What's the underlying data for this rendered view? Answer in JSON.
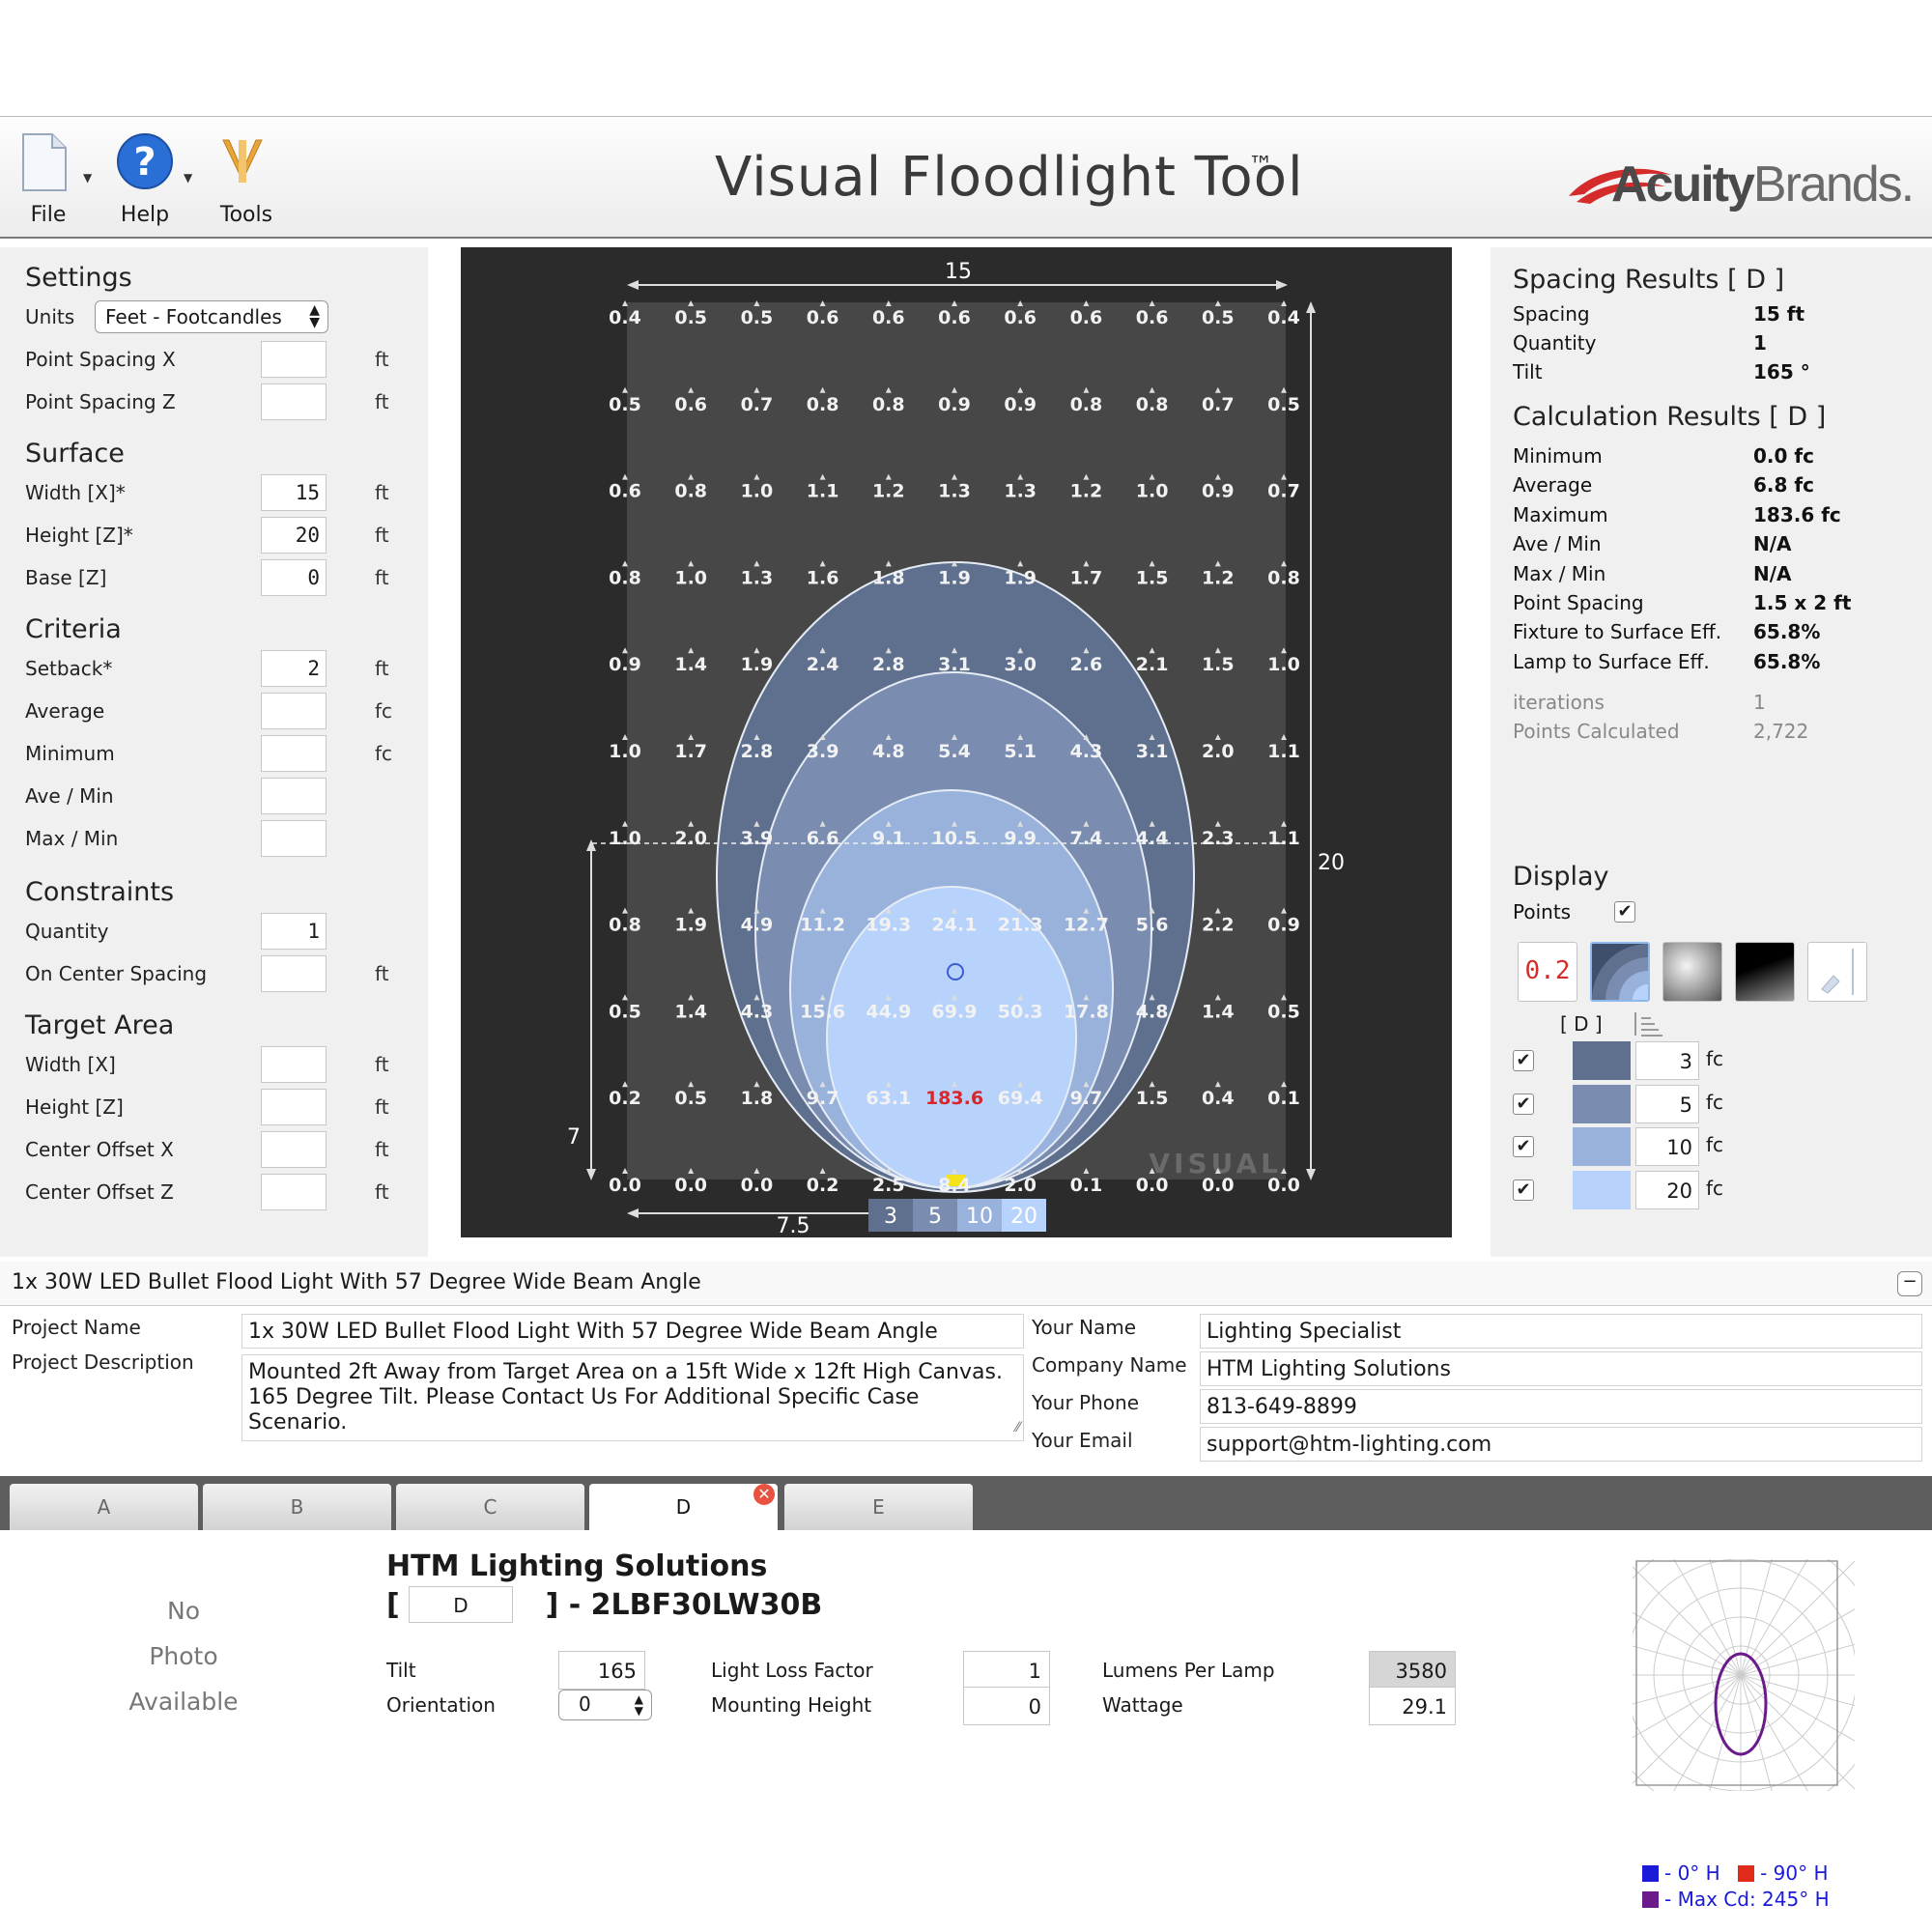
{
  "toolbar": {
    "file_label": "File",
    "help_label": "Help",
    "tools_label": "Tools"
  },
  "header": {
    "title": "Visual Floodlight Tool",
    "trademark": "™",
    "brand_bold": "Acuity",
    "brand_light": "Brands."
  },
  "settings": {
    "title": "Settings",
    "units_label": "Units",
    "units_value": "Feet - Footcandles",
    "point_spacing_x_label": "Point Spacing X",
    "point_spacing_x_value": "",
    "point_spacing_z_label": "Point Spacing Z",
    "point_spacing_z_value": "",
    "unit_ft": "ft",
    "unit_fc": "fc"
  },
  "surface": {
    "title": "Surface",
    "width_label": "Width  [X]*",
    "width_value": "15",
    "height_label": "Height [Z]*",
    "height_value": "20",
    "base_label": "Base   [Z]",
    "base_value": "0"
  },
  "criteria": {
    "title": "Criteria",
    "setback_label": "Setback*",
    "setback_value": "2",
    "average_label": "Average",
    "average_value": "",
    "minimum_label": "Minimum",
    "minimum_value": "",
    "ave_min_label": "Ave  /  Min",
    "ave_min_value": "",
    "max_min_label": "Max  /  Min",
    "max_min_value": ""
  },
  "constraints": {
    "title": "Constraints",
    "quantity_label": "Quantity",
    "quantity_value": "1",
    "ocs_label": "On Center Spacing",
    "ocs_value": ""
  },
  "target_area": {
    "title": "Target Area",
    "width_label": "Width [X]",
    "width_value": "",
    "height_label": "Height [Z]",
    "height_value": "",
    "offset_x_label": "Center Offset X",
    "offset_x_value": "",
    "offset_z_label": "Center Offset Z",
    "offset_z_value": ""
  },
  "plot": {
    "top_dimension": "15",
    "right_dimension": "20",
    "left_dimension": "7",
    "bottom_dimension": "7.5",
    "watermark": "VISUAL",
    "legend_levels": [
      "3",
      "5",
      "10",
      "20"
    ],
    "max_value": "183.6",
    "grid": [
      [
        "0.4",
        "0.5",
        "0.5",
        "0.6",
        "0.6",
        "0.6",
        "0.6",
        "0.6",
        "0.6",
        "0.5",
        "0.4"
      ],
      [
        "0.5",
        "0.6",
        "0.7",
        "0.8",
        "0.8",
        "0.9",
        "0.9",
        "0.8",
        "0.8",
        "0.7",
        "0.5"
      ],
      [
        "0.6",
        "0.8",
        "1.0",
        "1.1",
        "1.2",
        "1.3",
        "1.3",
        "1.2",
        "1.0",
        "0.9",
        "0.7"
      ],
      [
        "0.8",
        "1.0",
        "1.3",
        "1.6",
        "1.8",
        "1.9",
        "1.9",
        "1.7",
        "1.5",
        "1.2",
        "0.8"
      ],
      [
        "0.9",
        "1.4",
        "1.9",
        "2.4",
        "2.8",
        "3.1",
        "3.0",
        "2.6",
        "2.1",
        "1.5",
        "1.0"
      ],
      [
        "1.0",
        "1.7",
        "2.8",
        "3.9",
        "4.8",
        "5.4",
        "5.1",
        "4.3",
        "3.1",
        "2.0",
        "1.1"
      ],
      [
        "1.0",
        "2.0",
        "3.9",
        "6.6",
        "9.1",
        "10.5",
        "9.9",
        "7.4",
        "4.4",
        "2.3",
        "1.1"
      ],
      [
        "0.8",
        "1.9",
        "4.9",
        "11.2",
        "19.3",
        "24.1",
        "21.3",
        "12.7",
        "5.6",
        "2.2",
        "0.9"
      ],
      [
        "0.5",
        "1.4",
        "4.3",
        "15.6",
        "44.9",
        "69.9",
        "50.3",
        "17.8",
        "4.8",
        "1.4",
        "0.5"
      ],
      [
        "0.2",
        "0.5",
        "1.8",
        "9.7",
        "63.1",
        "183.6",
        "69.4",
        "9.7",
        "1.5",
        "0.4",
        "0.1"
      ],
      [
        "0.0",
        "0.0",
        "0.0",
        "0.2",
        "2.5",
        "8.4",
        "2.0",
        "0.1",
        "0.0",
        "0.0",
        "0.0"
      ]
    ]
  },
  "spacing_results": {
    "title": "Spacing Results  [ D ]",
    "spacing_label": "Spacing",
    "spacing_value": "15  ft",
    "quantity_label": "Quantity",
    "quantity_value": "1",
    "tilt_label": "Tilt",
    "tilt_value": "165 °"
  },
  "calc_results": {
    "title": "Calculation Results  [ D ]",
    "rows": [
      {
        "label": "Minimum",
        "value": "0.0  fc"
      },
      {
        "label": "Average",
        "value": "6.8  fc"
      },
      {
        "label": "Maximum",
        "value": "183.6  fc"
      },
      {
        "label": "Ave  /  Min",
        "value": "N/A"
      },
      {
        "label": "Max  /  Min",
        "value": "N/A"
      },
      {
        "label": "Point Spacing",
        "value": "1.5 x 2  ft"
      },
      {
        "label": "Fixture to Surface Eff.",
        "value": "65.8%"
      },
      {
        "label": "Lamp to Surface Eff.",
        "value": "65.8%"
      }
    ],
    "iterations_label": "iterations",
    "iterations_value": "1",
    "points_label": "Points Calculated",
    "points_value": "2,722"
  },
  "display": {
    "title": "Display",
    "points_label": "Points",
    "points_checked": "✔",
    "value_button_text": "0.2",
    "tab_tag": "[ D ]",
    "levels": [
      {
        "value": "3",
        "unit": "fc",
        "color": "#5f708f",
        "checked": "✔"
      },
      {
        "value": "5",
        "unit": "fc",
        "color": "#7a8db0",
        "checked": "✔"
      },
      {
        "value": "10",
        "unit": "fc",
        "color": "#98b2db",
        "checked": "✔"
      },
      {
        "value": "20",
        "unit": "fc",
        "color": "#b7d2fb",
        "checked": "✔"
      }
    ]
  },
  "project": {
    "header_title": "1x 30W LED Bullet Flood Light With 57 Degree Wide Beam Angle",
    "collapse_symbol": "−",
    "name_label": "Project Name",
    "name_value": "1x 30W LED Bullet Flood Light With 57 Degree Wide Beam Angle",
    "description_label": "Project Description",
    "description_line1": "Mounted 2ft Away from Target Area on a 15ft Wide x 12ft High Canvas.",
    "description_line2": "165 Degree Tilt. Please Contact Us For Additional Specific Case Scenario.",
    "your_name_label": "Your Name",
    "your_name_value": "Lighting Specialist",
    "company_label": "Company Name",
    "company_value": "HTM Lighting Solutions",
    "phone_label": "Your Phone",
    "phone_value": "813-649-8899",
    "email_label": "Your Email",
    "email_value": "support@htm-lighting.com"
  },
  "tabs": [
    {
      "label": "A"
    },
    {
      "label": "B"
    },
    {
      "label": "C"
    },
    {
      "label": "D"
    },
    {
      "label": "E"
    }
  ],
  "tab_close_symbol": "✕",
  "fixture": {
    "no_photo_line1": "No",
    "no_photo_line2": "Photo",
    "no_photo_line3": "Available",
    "company": "HTM Lighting Solutions",
    "catalog_prefix": "[",
    "catalog_tab": "D",
    "catalog_suffix": "] - 2LBF30LW30B",
    "tilt_label": "Tilt",
    "tilt_value": "165",
    "orientation_label": "Orientation",
    "orientation_value": "0",
    "llf_label": "Light Loss Factor",
    "llf_value": "1",
    "mounting_label": "Mounting Height",
    "mounting_value": "0",
    "lumens_label": "Lumens Per Lamp",
    "lumens_value": "3580",
    "wattage_label": "Wattage",
    "wattage_value": "29.1",
    "legend_0h": "- 0° H",
    "legend_90h": "- 90° H",
    "legend_maxcd": "- Max Cd: 245° H",
    "legend_colors": {
      "h0": "#1a1ad8",
      "h90": "#e02a1a",
      "maxcd": "#6a1a8a"
    }
  }
}
